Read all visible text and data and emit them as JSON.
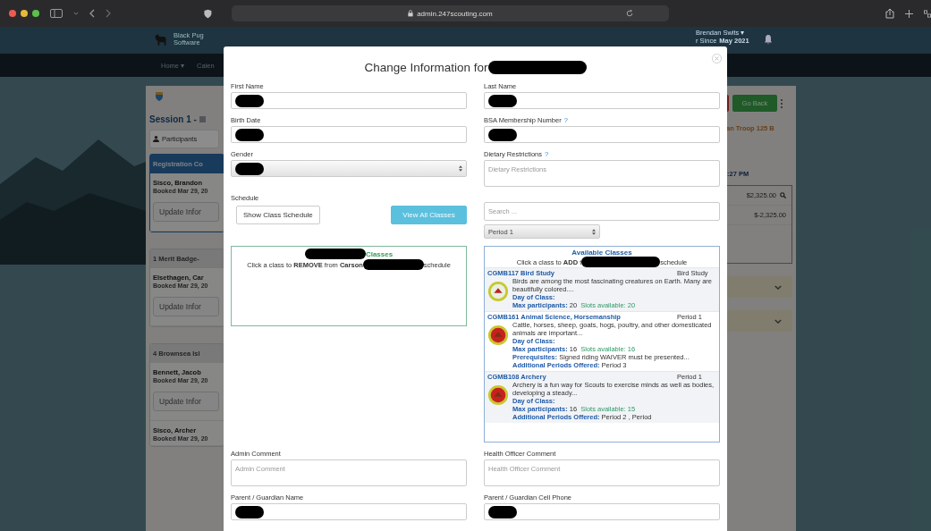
{
  "browser": {
    "url": "admin.247scouting.com"
  },
  "app_header": {
    "logo_text": "Black Pug Software",
    "user_name": "Brendan Swits ▾",
    "member_since_label": "r Since",
    "member_since": "May 2021"
  },
  "nav": [
    "Home ▾",
    "Calen"
  ],
  "left_panel": {
    "session_title": "Session 1 -",
    "tab": "Participants",
    "groups": [
      {
        "title": "Registration Co",
        "kind": "primary",
        "participants": [
          {
            "name": "Sisco, Brandon",
            "booked": "Booked Mar 29, 20",
            "button": "Update Infor"
          }
        ]
      },
      {
        "title": "1 Merit Badge-",
        "kind": "default",
        "participants": [
          {
            "name": "Elsethagen, Car",
            "booked": "Booked Mar 29, 20",
            "button": "Update Infor"
          }
        ]
      },
      {
        "title": "4 Brownsea Isl",
        "kind": "default",
        "participants": [
          {
            "name": "Bennett, Jacob",
            "booked": "Booked Mar 29, 20",
            "button": "Update Infor"
          },
          {
            "name": "Sisco, Archer",
            "booked": "Booked Mar 29, 20"
          }
        ]
      }
    ]
  },
  "right_panel": {
    "back_button": "Go Back",
    "troop": "an Troop 125 B",
    "time": ":27 PM",
    "amounts": [
      "$2,325.00",
      "$-2,325.00"
    ],
    "collapsed_rows": [
      {
        "expanded": false
      },
      {
        "expanded": false
      }
    ]
  },
  "modal": {
    "title": "Change Information for",
    "title_redacted": true,
    "fields_top": [
      {
        "label": "First Name",
        "kind": "text",
        "redacted": true
      },
      {
        "label": "Last Name",
        "kind": "text",
        "redacted": true
      },
      {
        "label": "Birth Date",
        "kind": "text",
        "redacted": true
      },
      {
        "label": "BSA Membership Number",
        "help": "?",
        "kind": "text",
        "redacted": true
      },
      {
        "label": "Gender",
        "kind": "select",
        "redacted": true
      },
      {
        "label": "Dietary Restrictions",
        "help": "?",
        "kind": "textarea",
        "placeholder": "Dietary Restrictions"
      }
    ],
    "schedule": {
      "label": "Schedule",
      "buttons": [
        {
          "label": "Show Class Schedule",
          "kind": "default"
        },
        {
          "label": "View All Classes",
          "kind": "primary"
        }
      ],
      "search": {
        "placeholder": "Search ..."
      },
      "period_select": {
        "value": "Period 1"
      },
      "enrolled": {
        "title_redacted": true,
        "title": "Classes",
        "instruction": "Click a class to **REMOVE** from **Carson**",
        "student_redacted": true,
        "instruction_end": "schedule"
      },
      "available": {
        "title": "Available Classes",
        "instruction": "Click a class to **ADD** t",
        "student_redacted": true,
        "instruction_end": "schedule",
        "classes": [
          {
            "code": "CGMB117",
            "name": "Bird Study",
            "period": "Bird Study",
            "description": "Birds are among the most fascinating creatures on Earth. Many are beautifully colored....",
            "details": [
              {
                "label": "Day of Class:"
              },
              {
                "label": "Max participants:",
                "value": "20",
                "note": "Slots available: 20"
              }
            ]
          },
          {
            "code": "CGMB161",
            "name": "Animal Science, Horsemanship",
            "period": "Period 1",
            "description": "Cattle, horses, sheep, goats, hogs, poultry, and other domesticated animals are important...",
            "details": [
              {
                "label": "Day of Class:"
              },
              {
                "label": "Max participants:",
                "value": "16",
                "note": "Slots available: 16"
              },
              {
                "label": "Prerequisites:",
                "value": "Signed riding WAIVER must be presented..."
              },
              {
                "label": "Additional Periods Offered:",
                "value": "Period 3"
              }
            ]
          },
          {
            "code": "CGMB108",
            "name": "Archery",
            "period": "Period 1",
            "description": "Archery is a fun way for Scouts to exercise minds as well as bodies, developing a steady...",
            "details": [
              {
                "label": "Day of Class:"
              },
              {
                "label": "Max participants:",
                "value": "16",
                "note": "Slots available: 15"
              },
              {
                "label": "Additional Periods Offered:",
                "value": "Period 2 , Period"
              }
            ]
          }
        ]
      }
    },
    "fields_bottom": [
      {
        "label": "Admin Comment",
        "kind": "textarea",
        "placeholder": "Admin Comment"
      },
      {
        "label": "Health Officer Comment",
        "kind": "textarea",
        "placeholder": "Health Officer Comment"
      },
      {
        "label": "Parent / Guardian Name",
        "kind": "text",
        "redacted": true
      },
      {
        "label": "Parent / Guardian Cell Phone",
        "kind": "text",
        "redacted": true
      }
    ]
  }
}
